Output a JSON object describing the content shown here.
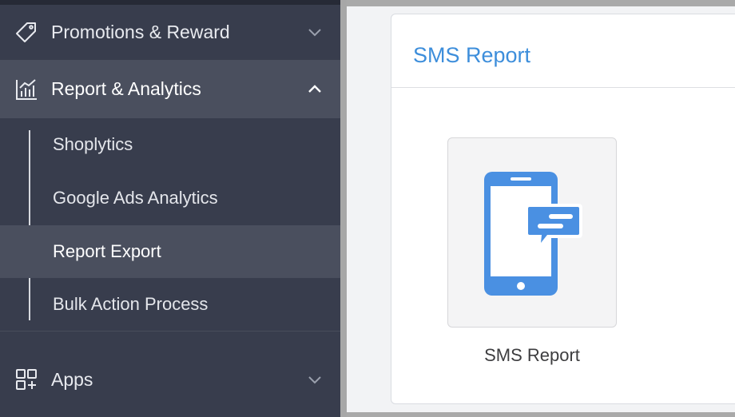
{
  "sidebar": {
    "items": [
      {
        "label": "Promotions & Reward",
        "icon": "tag-icon",
        "expanded": false
      },
      {
        "label": "Report & Analytics",
        "icon": "analytics-chart-icon",
        "expanded": true
      },
      {
        "label": "Apps",
        "icon": "apps-grid-icon",
        "expanded": false
      }
    ],
    "report_sub_items": [
      {
        "label": "Shoplytics",
        "active": false
      },
      {
        "label": "Google Ads Analytics",
        "active": false
      },
      {
        "label": "Report Export",
        "active": true
      },
      {
        "label": "Bulk Action Process",
        "active": false
      }
    ]
  },
  "main": {
    "card_title": "SMS Report",
    "tiles": [
      {
        "label": "SMS Report",
        "icon": "smartphone-message-icon"
      }
    ]
  },
  "colors": {
    "sidebar_bg": "#383d4d",
    "sidebar_active_bg": "#4a4f5e",
    "accent_blue": "#3d8edb",
    "icon_blue": "#4a90e2"
  }
}
